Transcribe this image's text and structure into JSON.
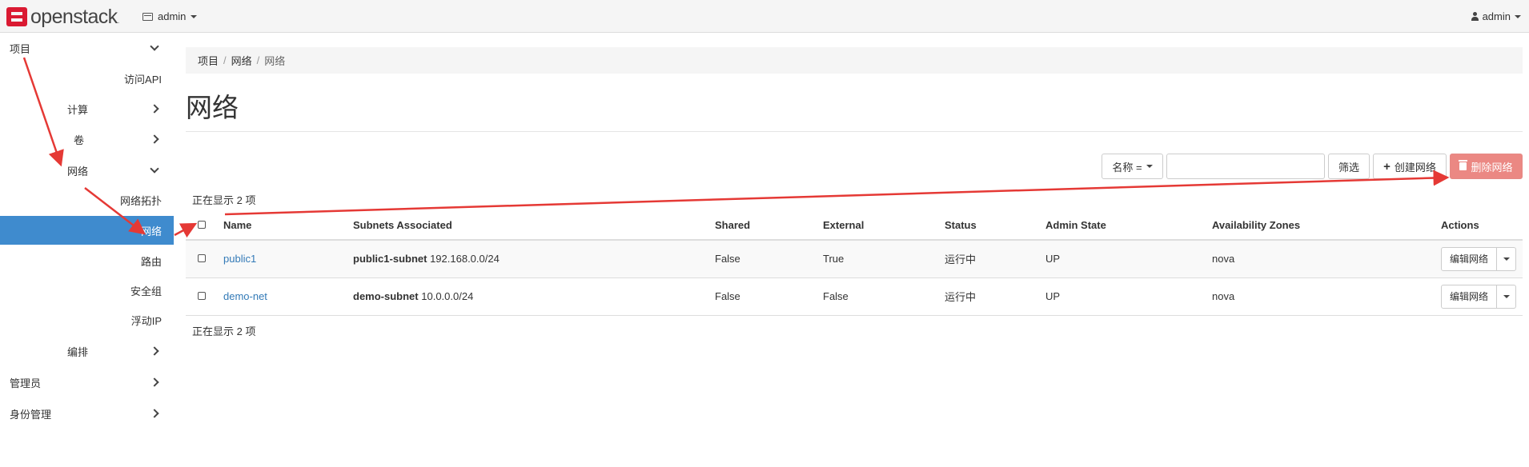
{
  "brand": {
    "name": "openstack",
    "trademark": "."
  },
  "topbar": {
    "project": "admin",
    "user": "admin"
  },
  "sidebar": {
    "items": [
      {
        "label": "项目",
        "kind": "section",
        "chevron": "down"
      },
      {
        "label": "访问API",
        "kind": "leaf"
      },
      {
        "label": "计算",
        "kind": "group",
        "chevron": "right"
      },
      {
        "label": "卷",
        "kind": "group",
        "chevron": "right"
      },
      {
        "label": "网络",
        "kind": "group",
        "chevron": "down"
      },
      {
        "label": "网络拓扑",
        "kind": "leaf"
      },
      {
        "label": "网络",
        "kind": "leaf",
        "active": true
      },
      {
        "label": "路由",
        "kind": "leaf"
      },
      {
        "label": "安全组",
        "kind": "leaf"
      },
      {
        "label": "浮动IP",
        "kind": "leaf"
      },
      {
        "label": "编排",
        "kind": "group",
        "chevron": "right"
      },
      {
        "label": "管理员",
        "kind": "section",
        "chevron": "right"
      },
      {
        "label": "身份管理",
        "kind": "section",
        "chevron": "right"
      }
    ]
  },
  "breadcrumb": [
    "项目",
    "网络",
    "网络"
  ],
  "page_title": "网络",
  "toolbar": {
    "filter_field": "名称 =",
    "filter_value": "",
    "filter_button": "筛选",
    "create_button": "创建网络",
    "delete_button": "删除网络"
  },
  "table": {
    "count_top": "正在显示 2 项",
    "count_bottom": "正在显示 2 项",
    "columns": [
      "Name",
      "Subnets Associated",
      "Shared",
      "External",
      "Status",
      "Admin State",
      "Availability Zones",
      "Actions"
    ],
    "rows": [
      {
        "name": "public1",
        "subnet_name": "public1-subnet",
        "subnet_cidr": "192.168.0.0/24",
        "shared": "False",
        "external": "True",
        "status": "运行中",
        "admin_state": "UP",
        "zones": "nova",
        "action": "编辑网络"
      },
      {
        "name": "demo-net",
        "subnet_name": "demo-subnet",
        "subnet_cidr": "10.0.0.0/24",
        "shared": "False",
        "external": "False",
        "status": "运行中",
        "admin_state": "UP",
        "zones": "nova",
        "action": "编辑网络"
      }
    ]
  },
  "colors": {
    "accent": "#3f8bce",
    "danger": "#eb8883",
    "link": "#337ab7",
    "annotation": "#e53935"
  }
}
